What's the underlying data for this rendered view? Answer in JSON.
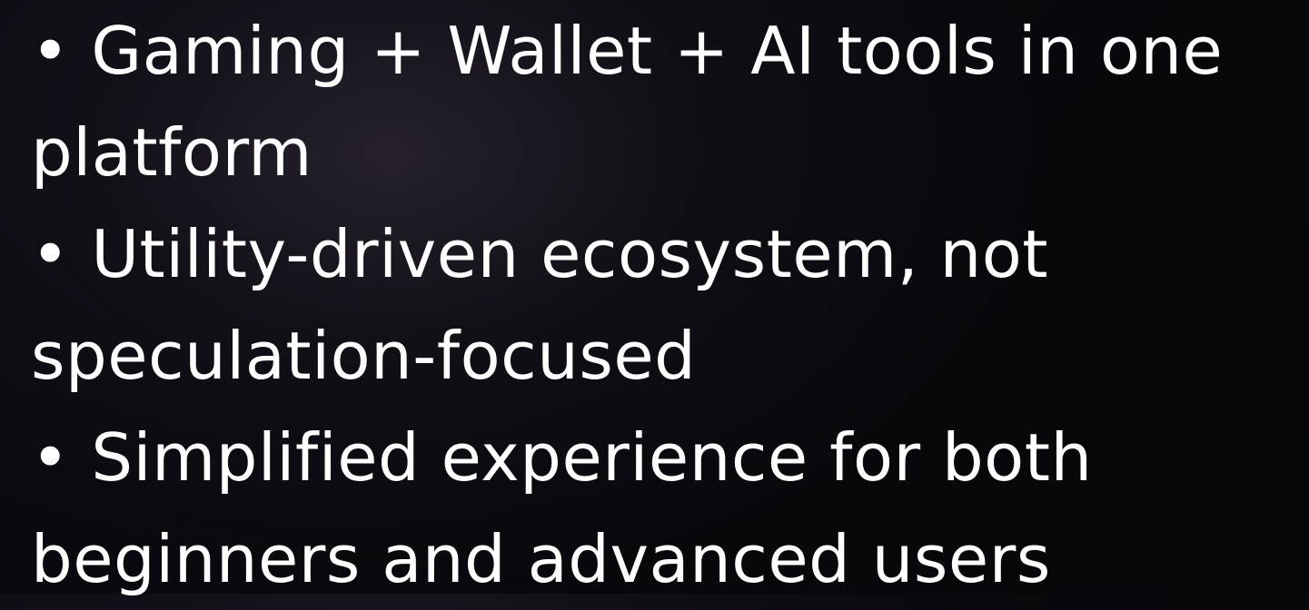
{
  "colors": {
    "background": "#0a080e",
    "text": "#ffffff"
  },
  "bullets": [
    {
      "line1": "• Gaming + Wallet + AI tools in one",
      "line2": "platform"
    },
    {
      "line1": "• Utility-driven ecosystem, not",
      "line2": "speculation-focused"
    },
    {
      "line1": "• Simplified experience for both",
      "line2": "beginners and advanced users"
    }
  ]
}
